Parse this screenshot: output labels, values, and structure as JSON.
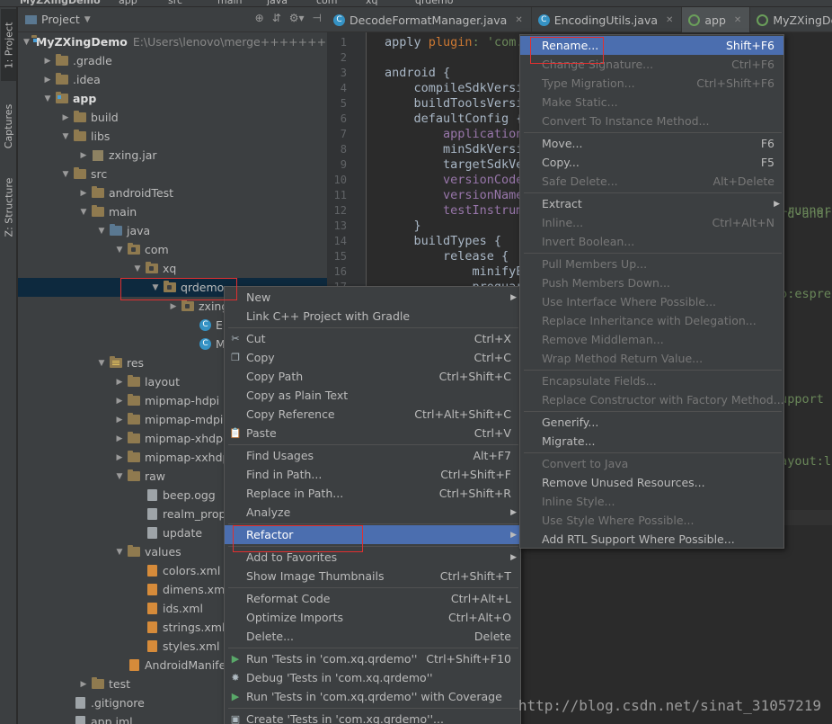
{
  "top_strip": {
    "project_crumb": "MyZXingDemo",
    "items": [
      "app",
      "src",
      "main",
      "java",
      "com",
      "xq",
      "qrdemo"
    ]
  },
  "left_strip": {
    "tabs": [
      "1: Project",
      "Captures",
      "Z: Structure"
    ]
  },
  "project_panel": {
    "header": "Project",
    "tree": [
      {
        "label": "MyZXingDemo",
        "extra": "E:\\Users\\lenovo\\merge++++++++",
        "icon": "module-folder-icon"
      },
      {
        "label": ".gradle",
        "icon": "folder-icon"
      },
      {
        "label": ".idea",
        "icon": "folder-icon"
      },
      {
        "label": "app",
        "icon": "module-folder-icon"
      },
      {
        "label": "build",
        "icon": "folder-icon"
      },
      {
        "label": "libs",
        "icon": "folder-icon"
      },
      {
        "label": "zxing.jar",
        "icon": "jar-icon"
      },
      {
        "label": "src",
        "icon": "folder-icon"
      },
      {
        "label": "androidTest",
        "icon": "folder-icon"
      },
      {
        "label": "main",
        "icon": "folder-icon"
      },
      {
        "label": "java",
        "icon": "source-folder-icon"
      },
      {
        "label": "com",
        "icon": "package-icon"
      },
      {
        "label": "xq",
        "icon": "package-icon"
      },
      {
        "label": "qrdemo",
        "icon": "package-icon"
      },
      {
        "label": "zxing",
        "icon": "package-icon"
      },
      {
        "label": "En",
        "icon": "class-icon"
      },
      {
        "label": "Ma",
        "icon": "class-icon"
      },
      {
        "label": "res",
        "icon": "res-folder-icon"
      },
      {
        "label": "layout",
        "icon": "folder-icon"
      },
      {
        "label": "mipmap-hdpi",
        "icon": "folder-icon"
      },
      {
        "label": "mipmap-mdpi",
        "icon": "folder-icon"
      },
      {
        "label": "mipmap-xhdpi",
        "icon": "folder-icon"
      },
      {
        "label": "mipmap-xxhdpi",
        "icon": "folder-icon"
      },
      {
        "label": "raw",
        "icon": "folder-icon"
      },
      {
        "label": "beep.ogg",
        "icon": "file-icon"
      },
      {
        "label": "realm_prope",
        "icon": "file-icon"
      },
      {
        "label": "update",
        "icon": "file-icon"
      },
      {
        "label": "values",
        "icon": "folder-icon"
      },
      {
        "label": "colors.xml",
        "icon": "xml-file-icon"
      },
      {
        "label": "dimens.xml",
        "icon": "xml-file-icon"
      },
      {
        "label": "ids.xml",
        "icon": "xml-file-icon"
      },
      {
        "label": "strings.xml",
        "icon": "xml-file-icon"
      },
      {
        "label": "styles.xml",
        "icon": "xml-file-icon"
      },
      {
        "label": "AndroidManifest.xr",
        "icon": "xml-file-icon"
      },
      {
        "label": "test",
        "icon": "folder-icon"
      },
      {
        "label": ".gitignore",
        "icon": "file-icon"
      },
      {
        "label": "app.iml",
        "icon": "file-icon"
      }
    ]
  },
  "editor_tabs": [
    "DecodeFormatManager.java",
    "EncodingUtils.java",
    "app",
    "MyZXingDemo"
  ],
  "line_numbers": [
    "1",
    "2",
    "3",
    "4",
    "5",
    "6",
    "7",
    "8",
    "9",
    "10",
    "11",
    "12",
    "13",
    "14",
    "15",
    "16",
    "17"
  ],
  "code_lines": [
    [
      {
        "t": "apply ",
        "c": ""
      },
      {
        "t": "plugin",
        "c": "kw"
      },
      {
        "t": ": 'com.",
        "c": "str"
      }
    ],
    [],
    [
      {
        "t": "android {",
        "c": ""
      }
    ],
    [
      {
        "t": "    compileSdkVersi",
        "c": ""
      }
    ],
    [
      {
        "t": "    buildToolsVersi",
        "c": ""
      }
    ],
    [
      {
        "t": "    defaultConfig {",
        "c": ""
      }
    ],
    [
      {
        "t": "        applicationId",
        "c": "fld"
      }
    ],
    [
      {
        "t": "        minSdkVersi",
        "c": ""
      }
    ],
    [
      {
        "t": "        targetSdkVe",
        "c": ""
      }
    ],
    [
      {
        "t": "        versionCode",
        "c": "fld"
      }
    ],
    [
      {
        "t": "        versionName",
        "c": "fld"
      }
    ],
    [
      {
        "t": "        testInstrum",
        "c": "fld"
      }
    ],
    [
      {
        "t": "    }",
        "c": ""
      }
    ],
    [
      {
        "t": "    buildTypes {",
        "c": ""
      }
    ],
    [
      {
        "t": "        release {",
        "c": ""
      }
    ],
    [
      {
        "t": "            minifyE",
        "c": ""
      }
    ],
    [
      {
        "t": "            proguar",
        "c": ""
      }
    ]
  ],
  "code_fragments": [
    "runner",
    "ard-andr",
    "so:espre",
    "support",
    "layout:l"
  ],
  "context_menu": [
    {
      "label": "New",
      "submenu": true
    },
    {
      "label": "Link C++ Project with Gradle"
    },
    {
      "sep": true
    },
    {
      "label": "Cut",
      "shortcut": "Ctrl+X",
      "icon": "scissors-icon"
    },
    {
      "label": "Copy",
      "shortcut": "Ctrl+C",
      "icon": "copy-icon"
    },
    {
      "label": "Copy Path",
      "shortcut": "Ctrl+Shift+C"
    },
    {
      "label": "Copy as Plain Text"
    },
    {
      "label": "Copy Reference",
      "shortcut": "Ctrl+Alt+Shift+C"
    },
    {
      "label": "Paste",
      "shortcut": "Ctrl+V",
      "icon": "paste-icon"
    },
    {
      "sep": true
    },
    {
      "label": "Find Usages",
      "shortcut": "Alt+F7"
    },
    {
      "label": "Find in Path...",
      "shortcut": "Ctrl+Shift+F"
    },
    {
      "label": "Replace in Path...",
      "shortcut": "Ctrl+Shift+R"
    },
    {
      "label": "Analyze",
      "submenu": true
    },
    {
      "sep": true
    },
    {
      "label": "Refactor",
      "submenu": true,
      "highlight": true
    },
    {
      "sep": true
    },
    {
      "label": "Add to Favorites",
      "submenu": true
    },
    {
      "label": "Show Image Thumbnails",
      "shortcut": "Ctrl+Shift+T"
    },
    {
      "sep": true
    },
    {
      "label": "Reformat Code",
      "shortcut": "Ctrl+Alt+L"
    },
    {
      "label": "Optimize Imports",
      "shortcut": "Ctrl+Alt+O"
    },
    {
      "label": "Delete...",
      "shortcut": "Delete"
    },
    {
      "sep": true
    },
    {
      "label": "Run 'Tests in 'com.xq.qrdemo''",
      "shortcut": "Ctrl+Shift+F10",
      "icon": "run-icon"
    },
    {
      "label": "Debug 'Tests in 'com.xq.qrdemo''",
      "icon": "debug-icon"
    },
    {
      "label": "Run 'Tests in 'com.xq.qrdemo'' with Coverage",
      "icon": "coverage-icon"
    },
    {
      "sep": true
    },
    {
      "label": "Create 'Tests in 'com.xq.qrdemo''...",
      "icon": "create-test-icon"
    }
  ],
  "refactor_menu": [
    {
      "label": "Rename...",
      "shortcut": "Shift+F6",
      "highlight": true
    },
    {
      "label": "Change Signature...",
      "shortcut": "Ctrl+F6",
      "disabled": true
    },
    {
      "label": "Type Migration...",
      "shortcut": "Ctrl+Shift+F6",
      "disabled": true
    },
    {
      "label": "Make Static...",
      "disabled": true
    },
    {
      "label": "Convert To Instance Method...",
      "disabled": true
    },
    {
      "sep": true
    },
    {
      "label": "Move...",
      "shortcut": "F6"
    },
    {
      "label": "Copy...",
      "shortcut": "F5"
    },
    {
      "label": "Safe Delete...",
      "shortcut": "Alt+Delete",
      "disabled": true
    },
    {
      "sep": true
    },
    {
      "label": "Extract",
      "submenu": true
    },
    {
      "label": "Inline...",
      "shortcut": "Ctrl+Alt+N",
      "disabled": true
    },
    {
      "label": "Invert Boolean...",
      "disabled": true
    },
    {
      "sep": true
    },
    {
      "label": "Pull Members Up...",
      "disabled": true
    },
    {
      "label": "Push Members Down...",
      "disabled": true
    },
    {
      "label": "Use Interface Where Possible...",
      "disabled": true
    },
    {
      "label": "Replace Inheritance with Delegation...",
      "disabled": true
    },
    {
      "label": "Remove Middleman...",
      "disabled": true
    },
    {
      "label": "Wrap Method Return Value...",
      "disabled": true
    },
    {
      "sep": true
    },
    {
      "label": "Encapsulate Fields...",
      "disabled": true
    },
    {
      "label": "Replace Constructor with Factory Method...",
      "disabled": true
    },
    {
      "sep": true
    },
    {
      "label": "Generify..."
    },
    {
      "label": "Migrate..."
    },
    {
      "sep": true
    },
    {
      "label": "Convert to Java",
      "disabled": true
    },
    {
      "label": "Remove Unused Resources..."
    },
    {
      "label": "Inline Style...",
      "disabled": true
    },
    {
      "label": "Use Style Where Possible...",
      "disabled": true
    },
    {
      "label": "Add RTL Support Where Possible..."
    }
  ],
  "watermark": "http://blog.csdn.net/sinat_31057219",
  "colors": {
    "highlight": "#4b6eaf",
    "annotation": "#e03030",
    "background": "#2b2b2b"
  }
}
